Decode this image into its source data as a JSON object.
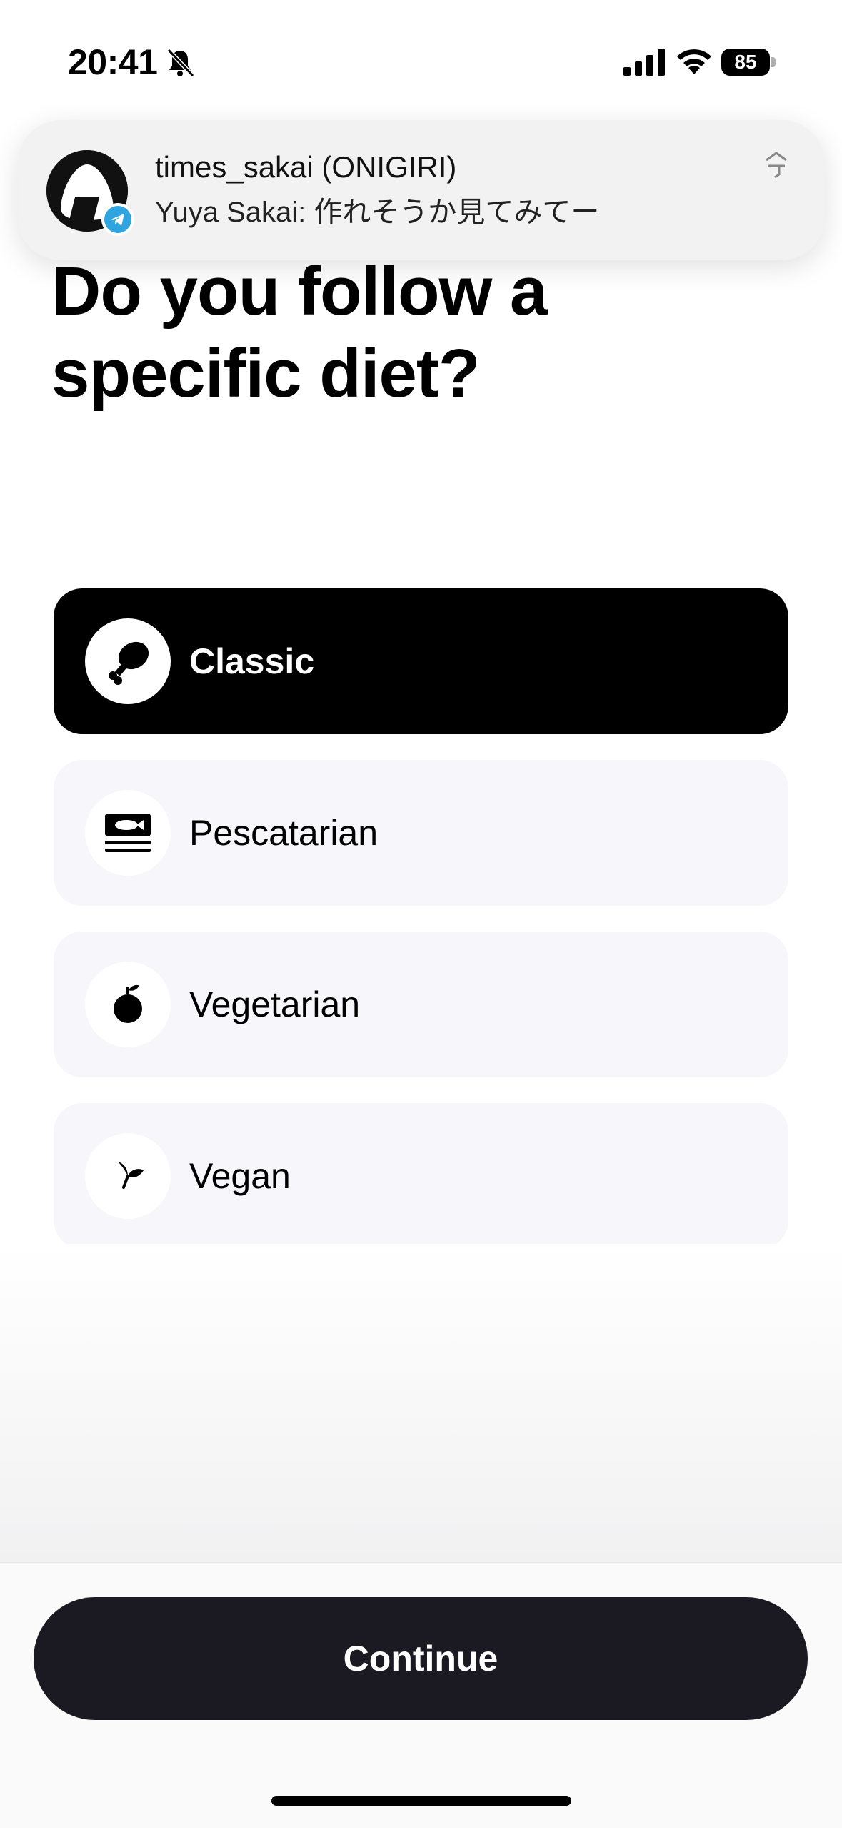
{
  "status_bar": {
    "time": "20:41",
    "battery": "85"
  },
  "notification": {
    "title": "times_sakai (ONIGIRI)",
    "body": "Yuya Sakai: 作れそうか見てみてー",
    "app_icon": "telegram-icon"
  },
  "heading": "Do you follow a specific diet?",
  "options": [
    {
      "label": "Classic",
      "icon": "drumstick-icon",
      "selected": true
    },
    {
      "label": "Pescatarian",
      "icon": "fish-icon",
      "selected": false
    },
    {
      "label": "Vegetarian",
      "icon": "apple-icon",
      "selected": false
    },
    {
      "label": "Vegan",
      "icon": "leaf-icon",
      "selected": false
    }
  ],
  "continue_label": "Continue",
  "colors": {
    "selected_bg": "#000000",
    "option_bg": "#f7f7fb",
    "button_bg": "#1b1a22",
    "telegram": "#2ea5e0"
  }
}
